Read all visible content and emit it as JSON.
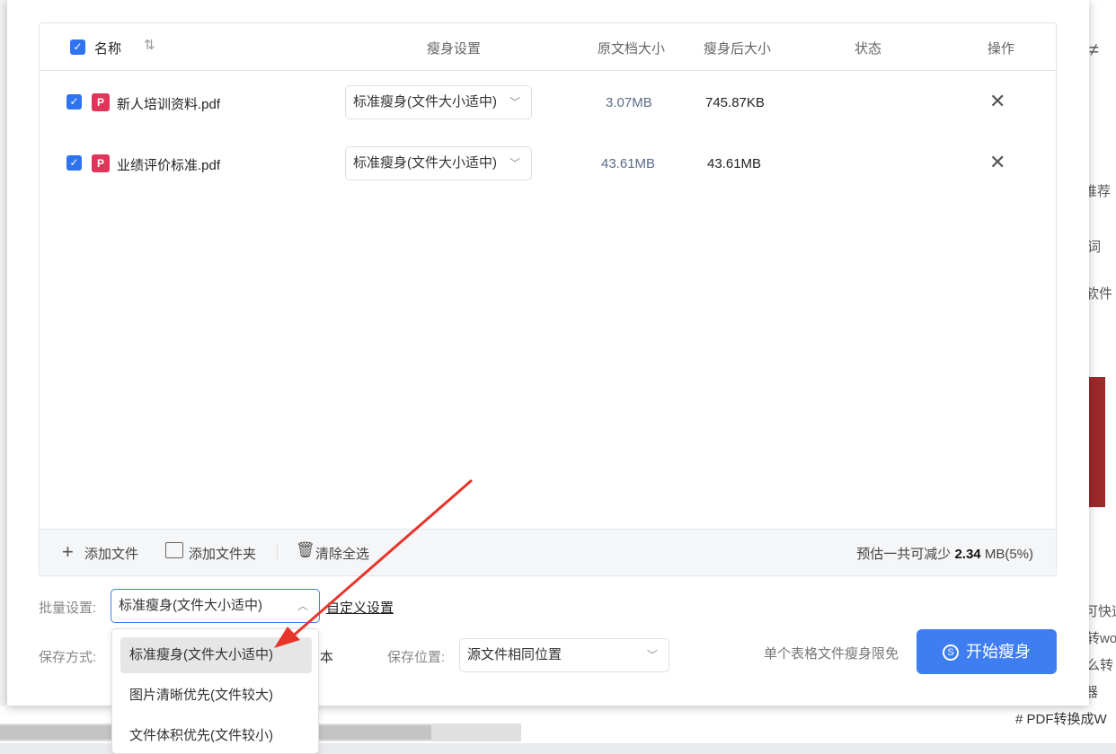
{
  "background": {
    "right_fragments": [
      "≠",
      "推荐",
      "词",
      "软件",
      "可快速",
      "转wo",
      "么转",
      "器"
    ],
    "bottom_tag": "# PDF转换成W"
  },
  "table": {
    "header": {
      "name": "名称",
      "setting": "瘦身设置",
      "original_size": "原文档大小",
      "compressed_size": "瘦身后大小",
      "status": "状态",
      "action": "操作"
    },
    "rows": [
      {
        "name": "新人培训资料.pdf",
        "setting": "标准瘦身(文件大小适中)",
        "original_size": "3.07MB",
        "compressed_size": "745.87KB",
        "status": ""
      },
      {
        "name": "业绩评价标准.pdf",
        "setting": "标准瘦身(文件大小适中)",
        "original_size": "43.61MB",
        "compressed_size": "43.61MB",
        "status": ""
      }
    ],
    "footer": {
      "add_file": "添加文件",
      "add_folder": "添加文件夹",
      "clear_all": "清除全选",
      "estimate_prefix": "预估一共可减少",
      "estimate_value": "2.34",
      "estimate_suffix": "MB(5%)"
    }
  },
  "batch": {
    "label": "批量设置:",
    "value": "标准瘦身(文件大小适中)",
    "custom_link": "自定义设置"
  },
  "save_mode": {
    "label": "保存方式:",
    "partial": "本"
  },
  "save_location": {
    "label": "保存位置:",
    "value": "源文件相同位置"
  },
  "free_note": "单个表格文件瘦身限免",
  "start_button": "开始瘦身",
  "dropdown_options": [
    "标准瘦身(文件大小适中)",
    "图片清晰优先(文件较大)",
    "文件体积优先(文件较小)"
  ],
  "colors": {
    "accent": "#3e7ef0",
    "pdf": "#e0345a",
    "arrow": "#e8352b"
  }
}
